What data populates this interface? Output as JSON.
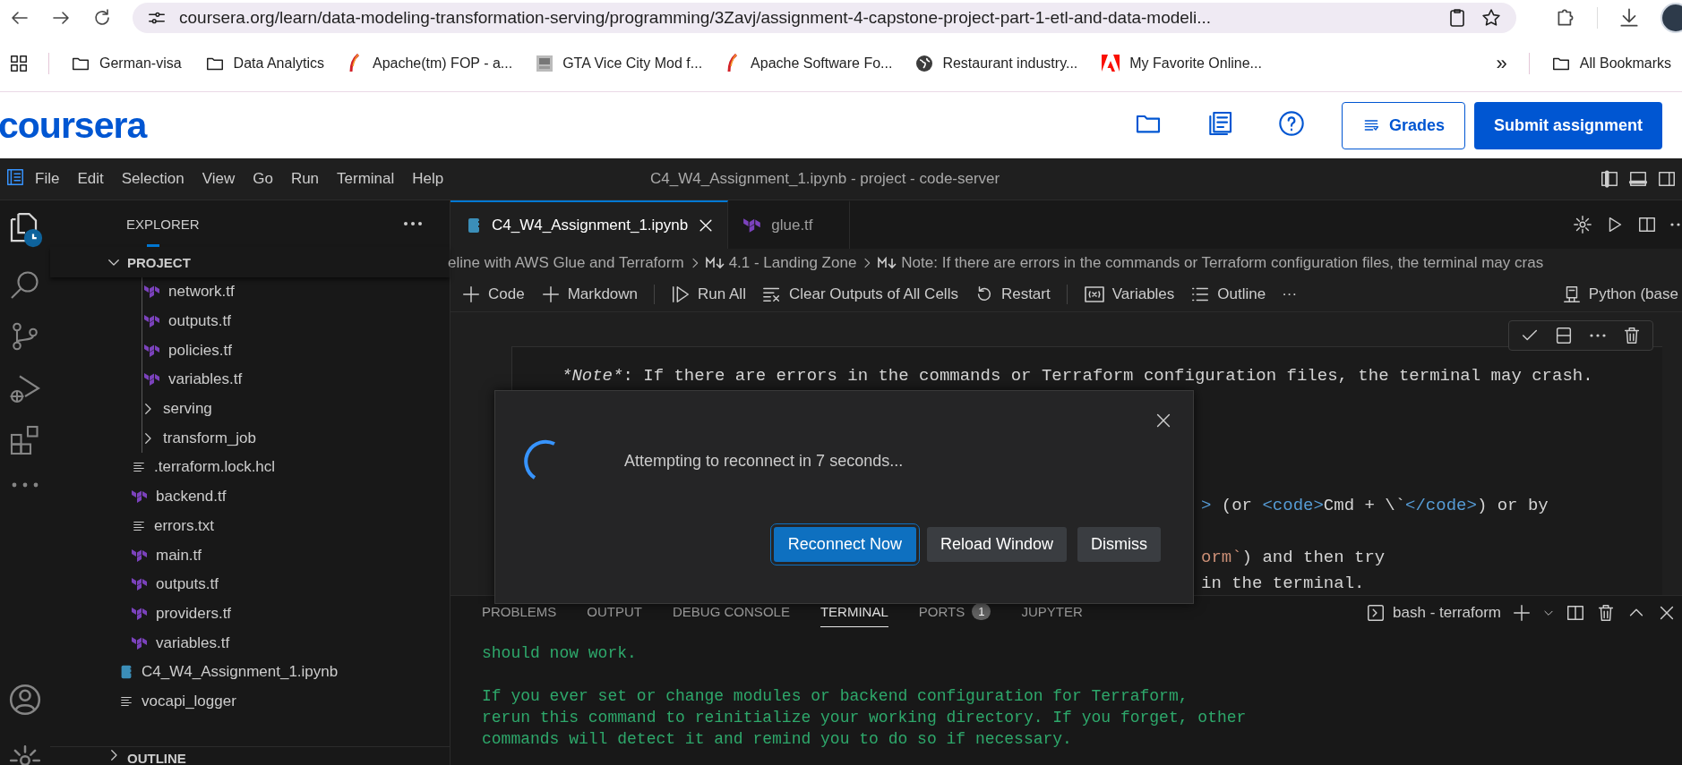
{
  "browser": {
    "url": "coursera.org/learn/data-modeling-transformation-serving/programming/3Zavj/assignment-4-capstone-project-part-1-etl-and-data-modeli...",
    "bookmarks": [
      {
        "label": "German-visa",
        "kind": "folder"
      },
      {
        "label": "Data Analytics",
        "kind": "folder"
      },
      {
        "label": "Apache(tm) FOP - a...",
        "kind": "feather"
      },
      {
        "label": "GTA Vice City Mod f...",
        "kind": "image"
      },
      {
        "label": "Apache Software Fo...",
        "kind": "feather"
      },
      {
        "label": "Restaurant industry...",
        "kind": "globe"
      },
      {
        "label": "My Favorite Online...",
        "kind": "adobe"
      }
    ],
    "overflow": "»",
    "all_bookmarks": "All Bookmarks"
  },
  "site_header": {
    "logo": "coursera",
    "grades": "Grades",
    "submit": "Submit assignment"
  },
  "menu": [
    "File",
    "Edit",
    "Selection",
    "View",
    "Go",
    "Run",
    "Terminal",
    "Help"
  ],
  "window_title": "C4_W4_Assignment_1.ipynb - project - code-server",
  "activity_bar": [
    {
      "kind": "explorer",
      "selected": true
    },
    {
      "kind": "search",
      "selected": false
    },
    {
      "kind": "source-control",
      "selected": false
    },
    {
      "kind": "run-debug",
      "selected": false
    },
    {
      "kind": "extensions",
      "selected": false
    },
    {
      "kind": "more",
      "selected": false
    }
  ],
  "explorer": {
    "title": "EXPLORER",
    "section": "PROJECT",
    "section_expanded": true,
    "outline": "OUTLINE",
    "tree": [
      {
        "children": [
          {
            "children": [
              {
                "label": "network.tf",
                "kind": "terraform"
              },
              {
                "label": "outputs.tf",
                "kind": "terraform"
              },
              {
                "label": "policies.tf",
                "kind": "terraform"
              },
              {
                "label": "variables.tf",
                "kind": "terraform"
              },
              {
                "label": "serving",
                "kind": "folder",
                "expanded": false
              },
              {
                "label": "transform_job",
                "kind": "folder",
                "expanded": false
              }
            ]
          },
          {
            "label": ".terraform.lock.hcl",
            "kind": "text"
          },
          {
            "label": "backend.tf",
            "kind": "terraform"
          },
          {
            "label": "errors.txt",
            "kind": "text"
          },
          {
            "label": "main.tf",
            "kind": "terraform"
          },
          {
            "label": "outputs.tf",
            "kind": "terraform"
          },
          {
            "label": "providers.tf",
            "kind": "terraform"
          },
          {
            "label": "variables.tf",
            "kind": "terraform"
          }
        ]
      },
      {
        "label": "C4_W4_Assignment_1.ipynb",
        "kind": "notebook"
      },
      {
        "label": "vocapi_logger",
        "kind": "text"
      }
    ]
  },
  "tabs": [
    {
      "label": "C4_W4_Assignment_1.ipynb",
      "kind": "notebook",
      "selected": true
    },
    {
      "label": "glue.tf",
      "kind": "terraform",
      "selected": false
    }
  ],
  "breadcrumbs": [
    {
      "label": "eline with AWS Glue and Terraform",
      "kind": "text"
    },
    {
      "label": "4.1 - Landing Zone",
      "kind": "markdown"
    },
    {
      "label": "Note: If there are errors in the commands or Terraform configuration files, the terminal may cras",
      "kind": "markdown"
    }
  ],
  "toolbar": [
    [
      {
        "label": "Code",
        "kind": "plus"
      },
      {
        "label": "Markdown",
        "kind": "plus"
      }
    ],
    [
      {
        "label": "Run All",
        "kind": "run"
      },
      {
        "label": "Clear Outputs of All Cells",
        "kind": "clear"
      },
      {
        "label": "Restart",
        "kind": "restart"
      }
    ],
    [
      {
        "label": "Variables",
        "kind": "variables"
      },
      {
        "label": "Outline",
        "kind": "outline"
      },
      {
        "label": "···",
        "kind": "more"
      }
    ]
  ],
  "kernel": "Python (base",
  "cell": {
    "lines": [
      [
        {
          "text": "*Note*",
          "kind": "italic"
        },
        {
          "text": ": If there are errors in the commands or Terraform configuration files, the terminal may crash.",
          "kind": "plain"
        }
      ]
    ],
    "fragments": [
      [
        {
          "text": ">",
          "kind": "tag"
        },
        {
          "text": " (or ",
          "kind": "plain"
        },
        {
          "text": "<code>",
          "kind": "tag"
        },
        {
          "text": "Cmd + \\`",
          "kind": "plain"
        },
        {
          "text": "</code>",
          "kind": "tag"
        },
        {
          "text": ") or by",
          "kind": "plain"
        }
      ],
      [
        {
          "text": "orm`",
          "kind": "code"
        },
        {
          "text": ") and then try",
          "kind": "plain"
        }
      ],
      [
        {
          "text": "in the terminal.",
          "kind": "plain"
        }
      ]
    ]
  },
  "dialog": {
    "message": "Attempting to reconnect in 7 seconds...",
    "buttons": [
      {
        "label": "Reconnect Now",
        "primary": true
      },
      {
        "label": "Reload Window",
        "primary": false
      },
      {
        "label": "Dismiss",
        "primary": false
      }
    ]
  },
  "panel": {
    "tabs": [
      {
        "label": "PROBLEMS",
        "selected": false
      },
      {
        "label": "OUTPUT",
        "selected": false
      },
      {
        "label": "DEBUG CONSOLE",
        "selected": false
      },
      {
        "label": "TERMINAL",
        "selected": true
      },
      {
        "label": "PORTS",
        "selected": false,
        "badge": "1"
      },
      {
        "label": "JUPYTER",
        "selected": false
      }
    ],
    "terminal_name": "bash - terraform",
    "output": [
      [
        "should now work."
      ],
      [
        "If you ever set or change modules or backend configuration for Terraform,",
        "rerun this command to reinitialize your working directory. If you forget, other",
        "commands will detect it and remind you to do so if necessary."
      ]
    ]
  }
}
